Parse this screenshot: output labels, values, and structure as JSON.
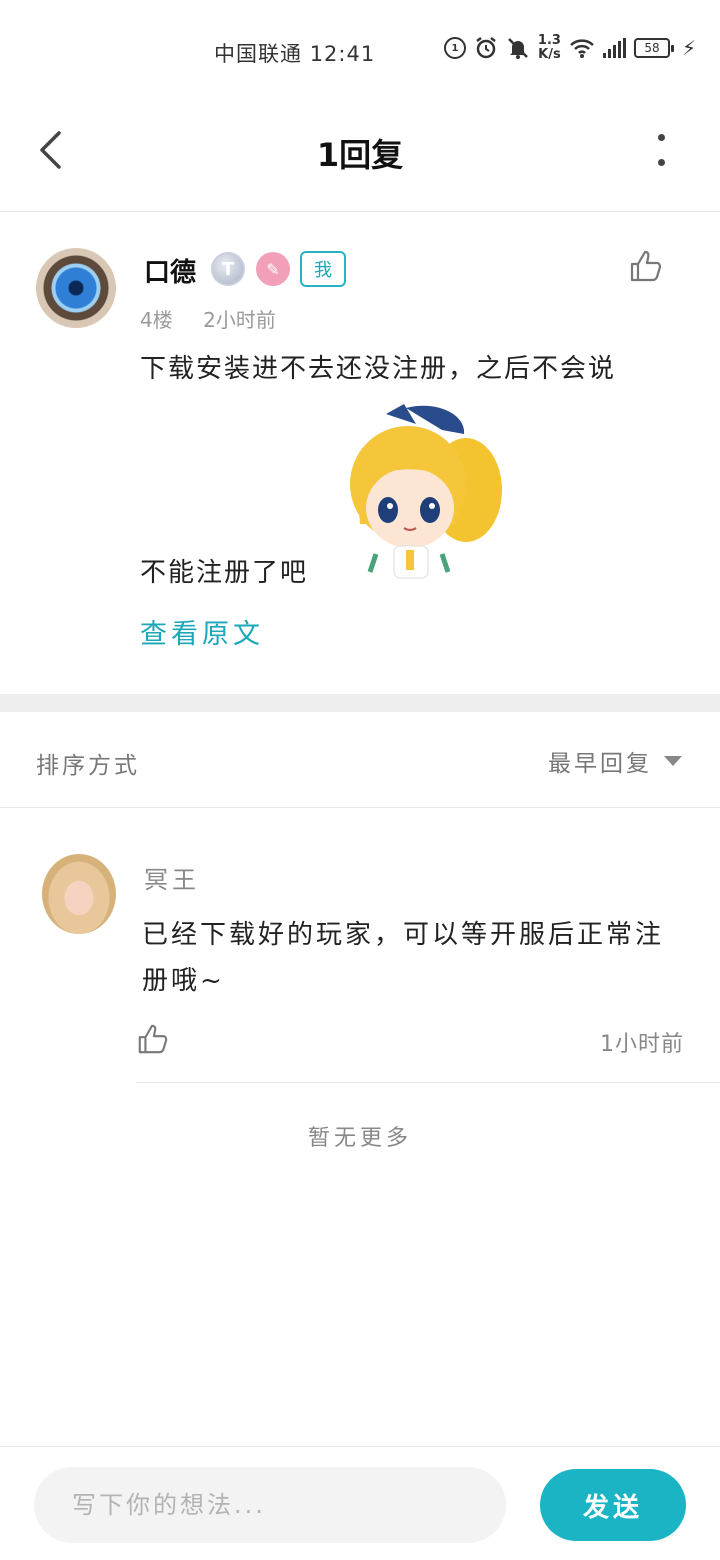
{
  "status_bar": {
    "carrier": "中国联通",
    "time": "12:41",
    "network_speed": "1.3",
    "network_speed_unit": "K/s",
    "battery": "58"
  },
  "nav": {
    "title": "1回复"
  },
  "post": {
    "author": "口德",
    "badge_t": "T",
    "badge_me": "我",
    "floor": "4楼",
    "time": "2小时前",
    "text_line1": "下载安装进不去还没注册，之后不会说",
    "text_line2": "不能注册了吧",
    "view_original": "查看原文"
  },
  "sort": {
    "label": "排序方式",
    "selected": "最早回复"
  },
  "reply": {
    "author": "冥王",
    "text": "已经下载好的玩家，可以等开服后正常注册哦~",
    "time": "1小时前"
  },
  "footer": {
    "no_more": "暂无更多"
  },
  "input": {
    "placeholder": "写下你的想法...",
    "send_label": "发送"
  },
  "colors": {
    "accent": "#1bb4c4",
    "muted_text": "#888888",
    "divider": "#e6e6e6"
  }
}
